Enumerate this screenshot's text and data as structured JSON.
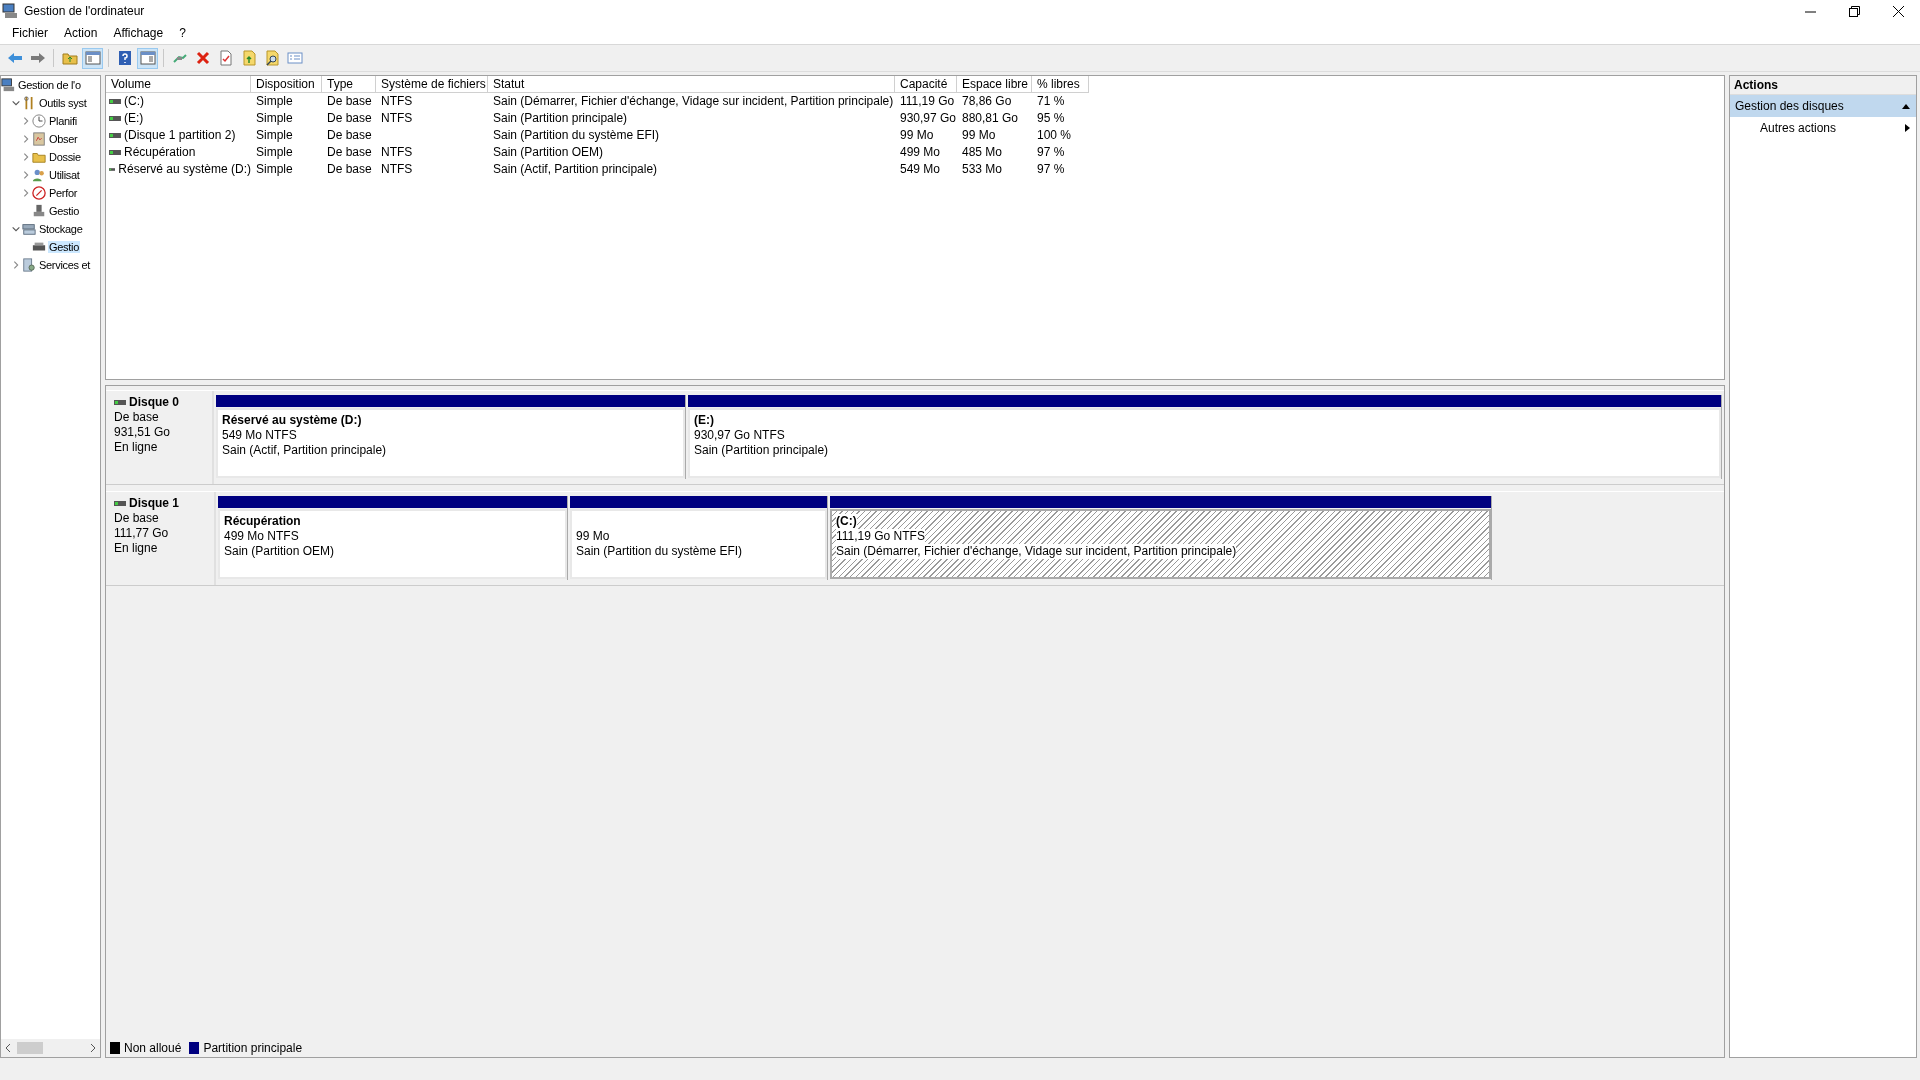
{
  "window": {
    "title": "Gestion de l'ordinateur"
  },
  "menu": [
    "Fichier",
    "Action",
    "Affichage",
    "?"
  ],
  "toolbar": [
    {
      "kind": "back",
      "pressed": false
    },
    {
      "kind": "forward",
      "pressed": false
    },
    {
      "kind": "sep"
    },
    {
      "kind": "up",
      "pressed": false
    },
    {
      "kind": "tree",
      "pressed": true
    },
    {
      "kind": "sep"
    },
    {
      "kind": "help",
      "pressed": false
    },
    {
      "kind": "pane",
      "pressed": true
    },
    {
      "kind": "sep"
    },
    {
      "kind": "connect",
      "pressed": false
    },
    {
      "kind": "delete",
      "pressed": false
    },
    {
      "kind": "check",
      "pressed": false
    },
    {
      "kind": "folderup",
      "pressed": false
    },
    {
      "kind": "search",
      "pressed": false
    },
    {
      "kind": "props",
      "pressed": false
    }
  ],
  "tree": [
    {
      "label": "Gestion de l'o",
      "kind": "computer",
      "selected": false,
      "children": [
        {
          "label": "Outils syst",
          "kind": "tools",
          "expanded": true,
          "selected": false,
          "children": [
            {
              "label": "Planifi",
              "kind": "clock",
              "expanded": false,
              "selected": false
            },
            {
              "label": "Obser",
              "kind": "log",
              "expanded": false,
              "selected": false
            },
            {
              "label": "Dossie",
              "kind": "share",
              "expanded": false,
              "selected": false
            },
            {
              "label": "Utilisat",
              "kind": "users",
              "expanded": false,
              "selected": false
            },
            {
              "label": "Perfor",
              "kind": "perf",
              "expanded": false,
              "selected": false
            },
            {
              "label": "Gestio",
              "kind": "device",
              "selected": false
            }
          ]
        },
        {
          "label": "Stockage",
          "kind": "storage",
          "expanded": true,
          "selected": false,
          "children": [
            {
              "label": "Gestio",
              "kind": "disk",
              "selected": true
            }
          ]
        },
        {
          "label": "Services et",
          "kind": "services",
          "expanded": false,
          "selected": false
        }
      ]
    }
  ],
  "table": {
    "columns": [
      "Volume",
      "Disposition",
      "Type",
      "Système de fichiers",
      "Statut",
      "Capacité",
      "Espace libre",
      "% libres"
    ],
    "rows": [
      [
        "(C:)",
        "Simple",
        "De base",
        "NTFS",
        "Sain (Démarrer, Fichier d'échange, Vidage sur incident, Partition principale)",
        "111,19 Go",
        "78,86 Go",
        "71 %"
      ],
      [
        "(E:)",
        "Simple",
        "De base",
        "NTFS",
        "Sain (Partition principale)",
        "930,97 Go",
        "880,81 Go",
        "95 %"
      ],
      [
        "(Disque 1 partition 2)",
        "Simple",
        "De base",
        "",
        "Sain (Partition du système EFI)",
        "99 Mo",
        "99 Mo",
        "100 %"
      ],
      [
        "Récupération",
        "Simple",
        "De base",
        "NTFS",
        "Sain (Partition OEM)",
        "499 Mo",
        "485 Mo",
        "97 %"
      ],
      [
        "Réservé au système (D:)",
        "Simple",
        "De base",
        "NTFS",
        "Sain (Actif, Partition principale)",
        "549 Mo",
        "533 Mo",
        "97 %"
      ]
    ]
  },
  "disks": [
    {
      "name": "Disque 0",
      "type": "De base",
      "size": "931,51 Go",
      "state": "En ligne",
      "partitions": [
        {
          "name": "Réservé au système  (D:)",
          "size": "549 Mo NTFS",
          "status": "Sain (Actif, Partition principale)",
          "kind": "primary",
          "selected": false
        },
        {
          "name": "(E:)",
          "size": "930,97 Go NTFS",
          "status": "Sain (Partition principale)",
          "kind": "primary",
          "selected": false
        }
      ]
    },
    {
      "name": "Disque 1",
      "type": "De base",
      "size": "111,77 Go",
      "state": "En ligne",
      "partitions": [
        {
          "name": "Récupération",
          "size": "499 Mo NTFS",
          "status": "Sain (Partition OEM)",
          "kind": "primary",
          "selected": false
        },
        {
          "size": "99 Mo",
          "status": "Sain (Partition du système EFI)",
          "kind": "primary",
          "selected": false
        },
        {
          "name": "(C:)",
          "size": "111,19 Go NTFS",
          "status": "Sain (Démarrer, Fichier d'échange, Vidage sur incident, Partition principale)",
          "kind": "primary",
          "selected": true
        }
      ]
    }
  ],
  "legend": [
    {
      "label": "Non alloué",
      "color": "#000000"
    },
    {
      "label": "Partition principale",
      "color": "#000080"
    }
  ],
  "actions": {
    "title": "Actions",
    "section": "Gestion des disques",
    "items": [
      "Autres actions"
    ]
  }
}
